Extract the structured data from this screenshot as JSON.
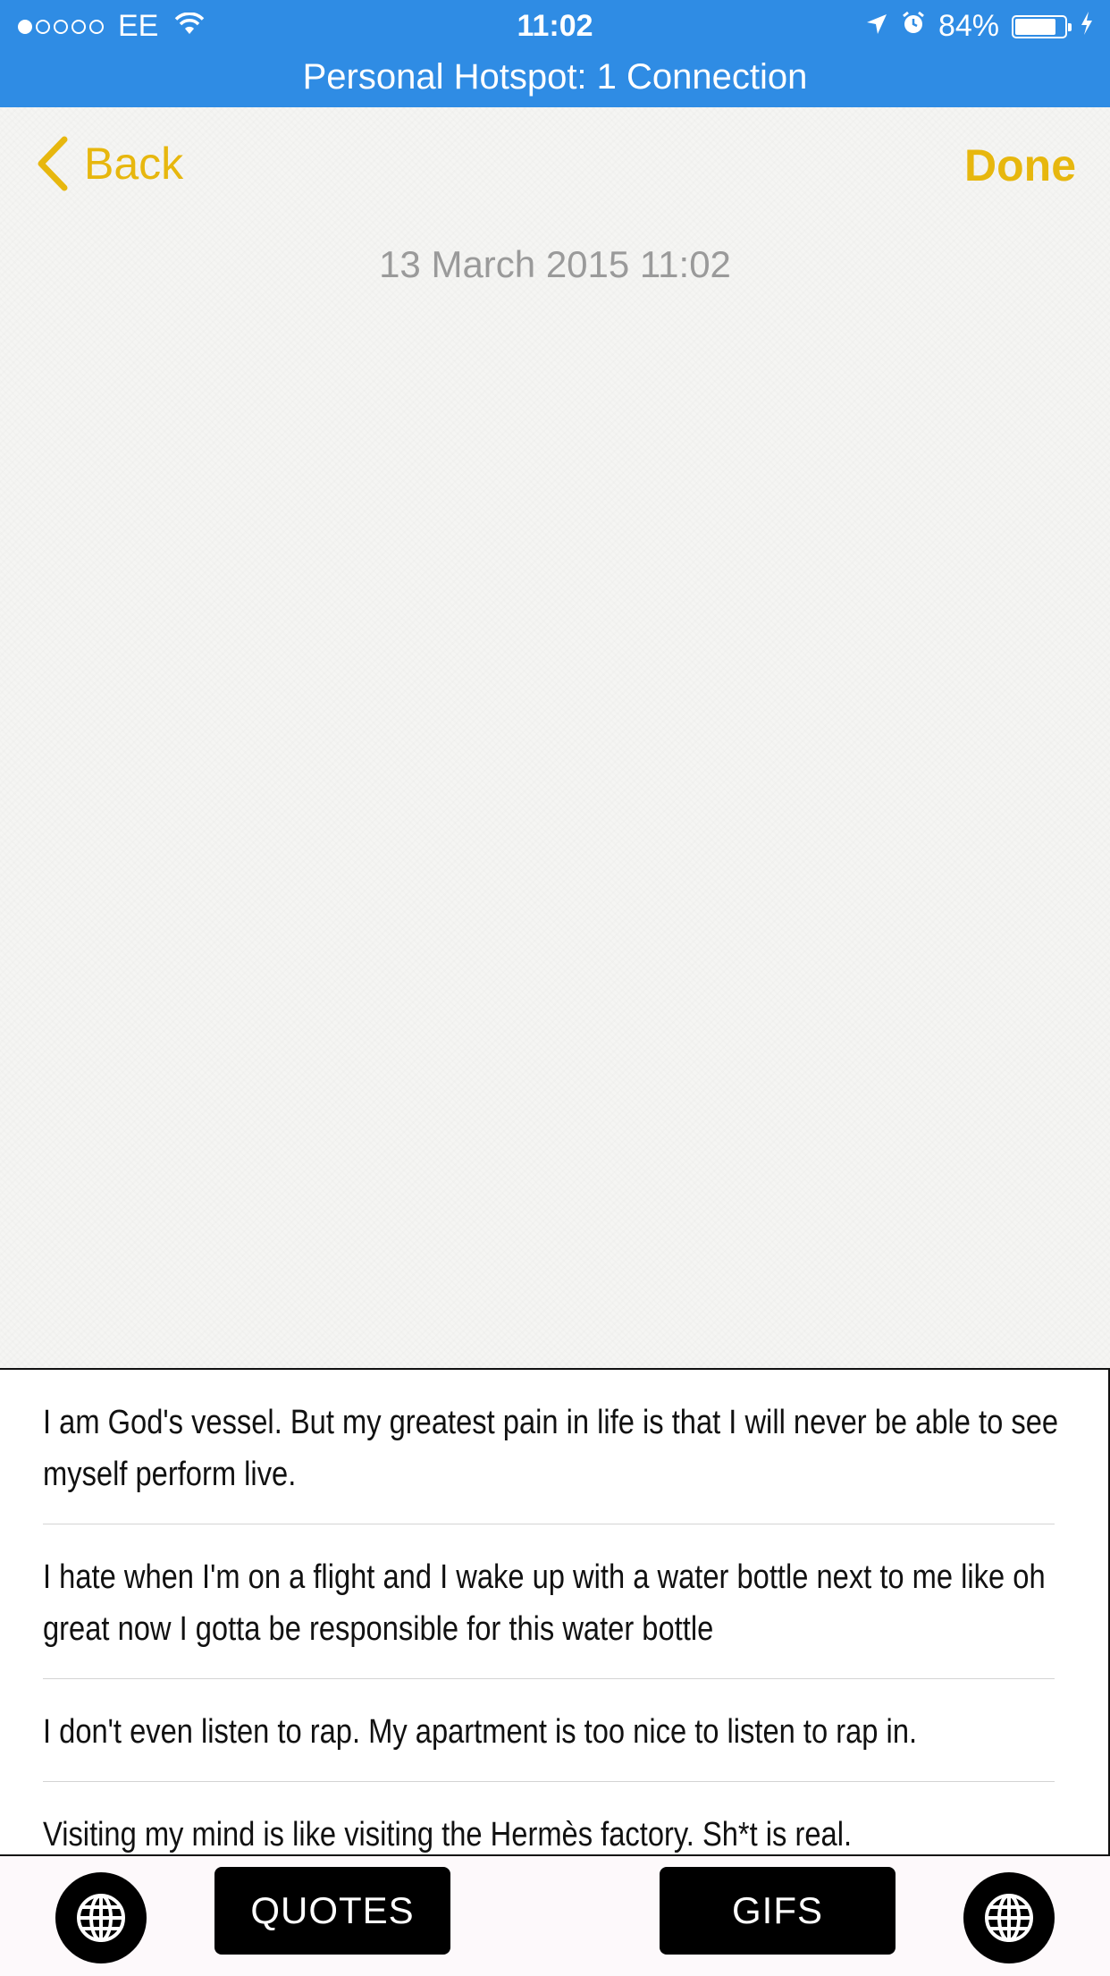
{
  "status_bar": {
    "carrier": "EE",
    "signal_bars_filled": 1,
    "signal_bars_total": 5,
    "time": "11:02",
    "battery_percent": "84%",
    "battery_level": 0.84,
    "icons": [
      "location-arrow-icon",
      "alarm-clock-icon",
      "charging-bolt-icon",
      "wifi-icon"
    ]
  },
  "hotspot_banner": "Personal Hotspot: 1 Connection",
  "nav": {
    "back_label": "Back",
    "done_label": "Done",
    "accent_color": "#e7b70e"
  },
  "note": {
    "date": "13 March 2015 11:02"
  },
  "keyboard": {
    "quotes": [
      "I am God's vessel. But my greatest pain in life is that I will never be able to see myself perform live.",
      "I hate when I'm on a flight and I wake up with a water bottle next to me like oh great now I gotta be responsible for this water bottle",
      "I don't even listen to rap. My apartment is too nice to listen to rap in.",
      "Visiting my mind is like visiting the Hermès factory. Sh*t is real."
    ],
    "quotes_button": "QUOTES",
    "gifs_button": "GIFS"
  }
}
